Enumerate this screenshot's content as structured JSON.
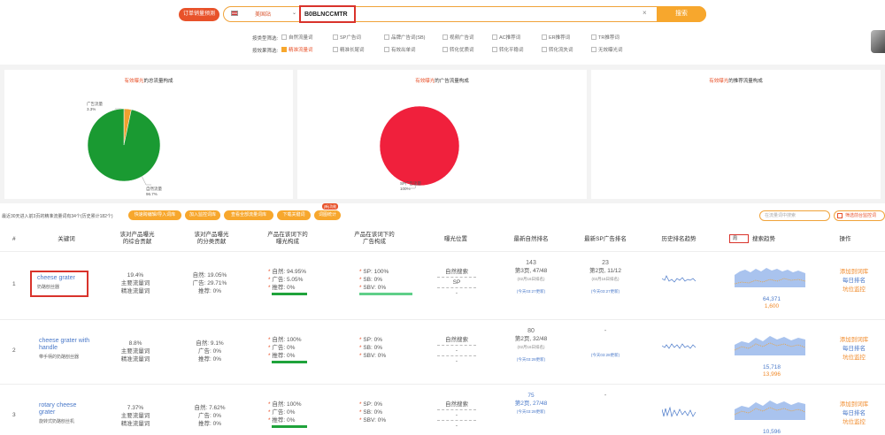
{
  "header": {
    "tool_button": "订单销量预测",
    "marketplace": "美国站",
    "query": "B0BLNCCMTR",
    "search_button": "搜索",
    "filter1_label": "按类型筛选:",
    "filter1_options": [
      {
        "label": "自然流量词",
        "checked": false
      },
      {
        "label": "SP广告词",
        "checked": false
      },
      {
        "label": "品牌广告词(SB)",
        "checked": false
      },
      {
        "label": "视频广告词",
        "checked": false
      },
      {
        "label": "AC推荐词",
        "checked": false
      },
      {
        "label": "ER推荐词",
        "checked": false
      },
      {
        "label": "TR推荐词",
        "checked": false
      }
    ],
    "filter2_label": "按效果筛选:",
    "filter2_options": [
      {
        "label": "精准流量词",
        "checked": true
      },
      {
        "label": "精准长尾词",
        "checked": false
      },
      {
        "label": "有效出单词",
        "checked": false
      },
      {
        "label": "转化优质词",
        "checked": false
      },
      {
        "label": "转化平稳词",
        "checked": false
      },
      {
        "label": "转化流失词",
        "checked": false
      },
      {
        "label": "无效曝光词",
        "checked": false
      }
    ]
  },
  "charts": [
    {
      "title_hl": "有效曝光",
      "title_rest": "的总流量构成",
      "slices": [
        {
          "label": "广告流量",
          "pct": "3.3%",
          "value": 3.3,
          "color": "#f0a030"
        },
        {
          "label": "自然流量",
          "pct": "96.7%",
          "value": 96.7,
          "color": "#1a9a32"
        }
      ]
    },
    {
      "title_hl": "有效曝光",
      "title_rest": "的广告流量构成",
      "slices": [
        {
          "label": "SP广告流量",
          "pct": "100%",
          "value": 100,
          "color": "#f0203c"
        }
      ]
    },
    {
      "title_hl": "有效曝光",
      "title_rest": "的推荐流量构成",
      "slices": []
    }
  ],
  "toolbar": {
    "summary": "最近30天进入前3页的精准流量词有34个(历史累计182个)",
    "buttons": [
      "快速跨编辑/导入词库",
      "加入监控词库",
      "查看全部流量词库",
      "下载关键词",
      "词图统计"
    ],
    "new_badge": "[新]功能",
    "search_placeholder": "在流量词中搜索",
    "checkbox_label": "筛选前台监控词"
  },
  "table": {
    "headers": [
      "#",
      "关键词",
      "该对产品曝光\n的综合贡献",
      "该对产品曝光\n的分类贡献",
      "产品在该词下的\n曝光构成",
      "产品在该词下的\n广告构成",
      "曝光位置",
      "最新自然排名",
      "最新SP广告排名",
      "历史排名趋势",
      "搜索趋势",
      "操作"
    ],
    "trend_tag": "周",
    "rows": [
      {
        "index": "1",
        "keyword": "cheese grater",
        "keyword_cn": "奶酪刨丝器",
        "contribution": [
          "19.4%",
          "主要流量词",
          "精准流量词"
        ],
        "category": [
          "自然: 19.05%",
          "广告: 29.71%",
          "推荐: 0%"
        ],
        "exposure": [
          "自然: 94.95%",
          "广告: 5.05%",
          "推荐: 0%"
        ],
        "ad": [
          "SP: 100%",
          "SB: 0%",
          "SBV: 0%"
        ],
        "position": [
          "自然搜索",
          "SP",
          "-"
        ],
        "natural_rank": {
          "num": "143",
          "page": "第3页, 47/48",
          "date": "(02月16日排名)",
          "note": "(今天03:27更新)"
        },
        "sp_rank": {
          "num": "23",
          "page": "第2页, 11/12",
          "date": "(02月16日排名)",
          "note": "(今天03:27更新)"
        },
        "volume": "64,371",
        "volume2": "1,600",
        "ops": [
          "添加到词库",
          "每日排名",
          "坑位监控"
        ]
      },
      {
        "index": "2",
        "keyword": "cheese grater with handle",
        "keyword_cn": "带手柄的奶酪刨丝器",
        "contribution": [
          "8.8%",
          "主要流量词",
          "精准流量词"
        ],
        "category": [
          "自然: 9.1%",
          "广告: 0%",
          "推荐: 0%"
        ],
        "exposure": [
          "自然: 100%",
          "广告: 0%",
          "推荐: 0%"
        ],
        "ad": [
          "SP: 0%",
          "SB: 0%",
          "SBV: 0%"
        ],
        "position": [
          "自然搜索",
          "-",
          "-"
        ],
        "natural_rank": {
          "num": "80",
          "page": "第2页, 32/48",
          "date": "(02月16日排名)",
          "note": "(今天03:28更新)"
        },
        "sp_rank": {
          "num": "-",
          "page": "",
          "date": "",
          "note": "(今天03:28更新)"
        },
        "volume": "15,718",
        "volume2": "13,996",
        "ops": [
          "添加到词库",
          "每日排名",
          "坑位监控"
        ]
      },
      {
        "index": "3",
        "keyword": "rotary cheese grater",
        "keyword_cn": "旋转式奶酪刨丝机",
        "contribution": [
          "7.37%",
          "主要流量词",
          "精准流量词"
        ],
        "category": [
          "自然: 7.62%",
          "广告: 0%",
          "推荐: 0%"
        ],
        "exposure": [
          "自然: 100%",
          "广告: 0%",
          "推荐: 0%"
        ],
        "ad": [
          "SP: 0%",
          "SB: 0%",
          "SBV: 0%"
        ],
        "position": [
          "自然搜索",
          "-",
          "-"
        ],
        "natural_rank": {
          "num": "75",
          "page": "第2页, 27/48",
          "date": "(今天03:28更新)",
          "note": ""
        },
        "sp_rank": {
          "num": "-",
          "page": "",
          "date": "",
          "note": ""
        },
        "volume": "10,596",
        "volume2": "",
        "ops": [
          "添加到词库",
          "每日排名",
          "坑位监控"
        ]
      }
    ]
  }
}
